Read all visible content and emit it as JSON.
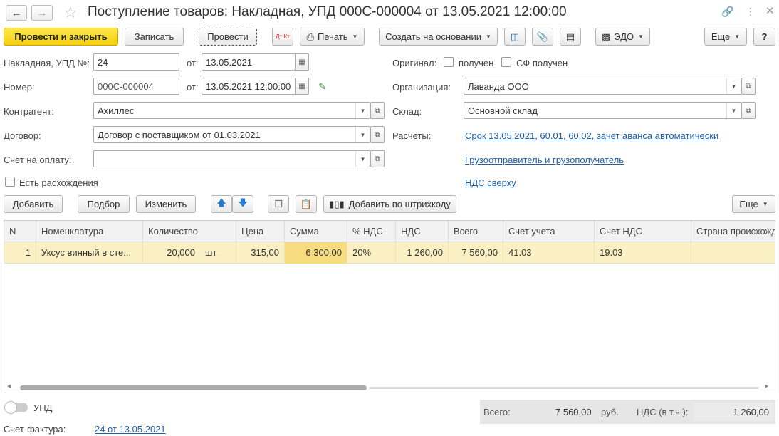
{
  "window": {
    "title": "Поступление товаров: Накладная, УПД 000С-000004 от 13.05.2021 12:00:00"
  },
  "toolbar": {
    "post_close": "Провести и закрыть",
    "save": "Записать",
    "post": "Провести",
    "dt_kt": "Дт Кт",
    "print": "Печать",
    "create_based": "Создать на основании",
    "edo": "ЭДО",
    "more": "Еще",
    "help": "?"
  },
  "form": {
    "invoice_label": "Накладная, УПД №:",
    "invoice_no": "24",
    "from_label": "от:",
    "invoice_date": "13.05.2021",
    "number_label": "Номер:",
    "number": "000С-000004",
    "number_datetime": "13.05.2021 12:00:00",
    "counterparty_label": "Контрагент:",
    "counterparty": "Ахиллес",
    "contract_label": "Договор:",
    "contract": "Договор с поставщиком от 01.03.2021",
    "payment_invoice_label": "Счет на оплату:",
    "payment_invoice": "",
    "discrepancy_label": "Есть расхождения",
    "original_label": "Оригинал:",
    "received_label": "получен",
    "sf_received_label": "СФ получен",
    "organization_label": "Организация:",
    "organization": "Лаванда ООО",
    "warehouse_label": "Склад:",
    "warehouse": "Основной склад",
    "settlements_label": "Расчеты:",
    "settlements_link": "Срок 13.05.2021, 60.01, 60.02, зачет аванса автоматически",
    "shipper_link": "Грузоотправитель и грузополучатель",
    "vat_link": "НДС сверху"
  },
  "table_toolbar": {
    "add": "Добавить",
    "pick": "Подбор",
    "change": "Изменить",
    "barcode": "Добавить по штрихкоду",
    "more": "Еще"
  },
  "table": {
    "headers": [
      "N",
      "Номенклатура",
      "Количество",
      "Цена",
      "Сумма",
      "% НДС",
      "НДС",
      "Всего",
      "Счет учета",
      "Счет НДС",
      "Страна происхожд"
    ],
    "rows": [
      {
        "n": "1",
        "item": "Уксус винный в сте...",
        "qty": "20,000",
        "unit": "шт",
        "price": "315,00",
        "sum": "6 300,00",
        "vat_rate": "20%",
        "vat": "1 260,00",
        "total": "7 560,00",
        "account": "41.03",
        "vat_account": "19.03",
        "country": ""
      }
    ]
  },
  "footer": {
    "upd_label": "УПД",
    "sf_label": "Счет-фактура:",
    "sf_link": "24 от 13.05.2021",
    "total_label": "Всего:",
    "total_value": "7 560,00",
    "currency": "руб.",
    "vat_label": "НДС (в т.ч.):",
    "vat_value": "1 260,00"
  }
}
